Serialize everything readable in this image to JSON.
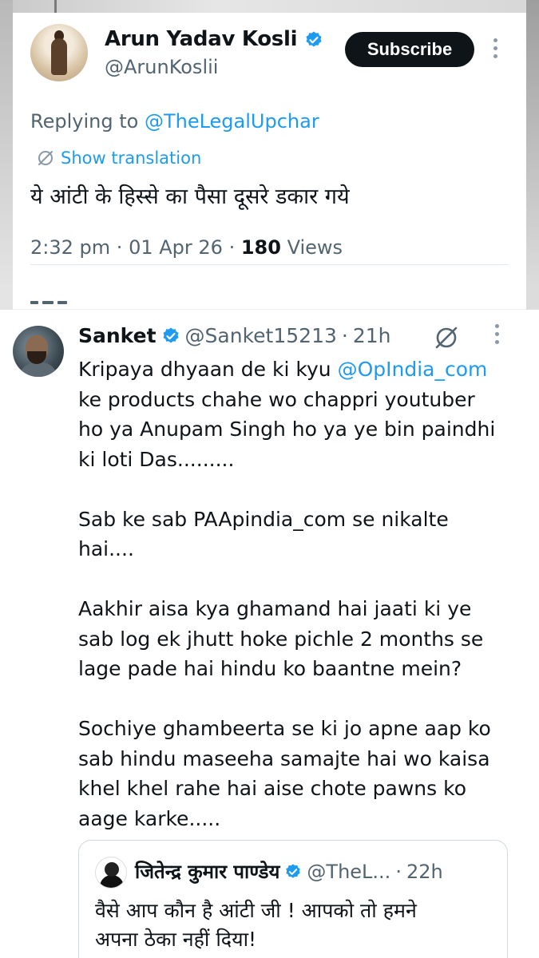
{
  "reply_tweet": {
    "author_name": "Arun Yadav Kosli",
    "author_handle": "@ArunKoslii",
    "subscribe_label": "Subscribe",
    "replying_prefix": "Replying to",
    "replying_to": "@TheLegalUpchar",
    "show_translation": "Show translation",
    "text": "ये आंटी के हिस्से का पैसा दूसरे डकार गये",
    "time": "2:32 pm",
    "date": "01 Apr 26",
    "views_count": "180",
    "views_label": "Views",
    "separator": "·"
  },
  "main_tweet": {
    "author_name": "Sanket",
    "author_handle": "@Sanket15213",
    "separator": "·",
    "time_ago": "21h",
    "lines": {
      "l1_prefix": "Kripaya dhyaan de ki kyu ",
      "l1_mention": "@OpIndia_com",
      "l2": "ke products chahe wo chappri youtuber",
      "l3": "ho ya Anupam Singh ho ya ye bin paindhi",
      "l4": "ki loti Das.........",
      "l5": "Sab ke sab PAApindia_com se nikalte",
      "l6": "hai....",
      "l7": "Aakhir aisa kya ghamand hai jaati ki ye",
      "l8": "sab log ek jhutt hoke pichle 2 months se",
      "l9": "lage pade hai hindu ko baantne mein?",
      "l10": "Sochiye ghambeerta se ki jo apne aap ko",
      "l11": "sab hindu maseeha samajte hai wo kaisa",
      "l12": "khel khel rahe hai aise chote pawns ko",
      "l13": "aage karke....."
    }
  },
  "quoted_tweet": {
    "author_name": "जितेन्द्र कुमार पाण्डेय",
    "author_handle": "@TheL...",
    "separator": "·",
    "time_ago": "22h",
    "line1": "वैसे आप कौन है आंटी जी !  आपको तो हमने",
    "line2": "अपना ठेका नहीं दिया!"
  },
  "colors": {
    "accent": "#1d9bf0",
    "text_primary": "#0f1419",
    "text_secondary": "#536471",
    "verified_badge": "#1d9bf0",
    "subscribe_bg": "#0f1419"
  },
  "icons": {
    "verified": "verified-badge-icon",
    "translate": "no-translate-icon",
    "more": "more-vertical-icon"
  }
}
